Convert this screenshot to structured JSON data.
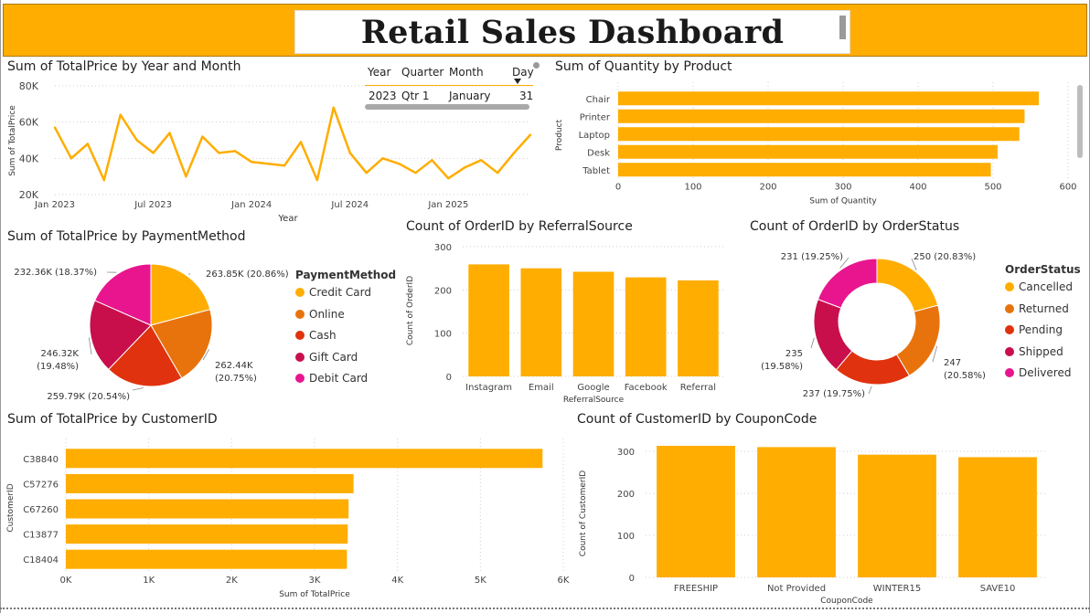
{
  "dashboard": {
    "title": "Retail Sales Dashboard"
  },
  "colors": {
    "accent": "#FFAD00",
    "credit_card": "#FFAD00",
    "online": "#E8730C",
    "cash": "#E0320E",
    "gift_card": "#C80F4C",
    "debit_card": "#E8158E"
  },
  "slicer": {
    "headers": [
      "Year",
      "Quarter",
      "Month",
      "Day"
    ],
    "values": [
      "2023",
      "Qtr 1",
      "January",
      "31"
    ]
  },
  "panels": {
    "line": {
      "title": "Sum of TotalPrice by Year and Month"
    },
    "product": {
      "title": "Sum of Quantity by Product"
    },
    "payment": {
      "title": "Sum of TotalPrice by PaymentMethod"
    },
    "referral": {
      "title": "Count of OrderID by ReferralSource"
    },
    "status": {
      "title": "Count of OrderID by OrderStatus"
    },
    "customer": {
      "title": "Sum of TotalPrice by CustomerID"
    },
    "coupon": {
      "title": "Count of CustomerID by CouponCode"
    }
  },
  "chart_data": [
    {
      "id": "line",
      "type": "line",
      "title": "Sum of TotalPrice by Year and Month",
      "xlabel": "Year",
      "ylabel": "Sum of TotalPrice",
      "ylim": [
        20000,
        80000
      ],
      "y_ticks": [
        "20K",
        "40K",
        "60K",
        "80K"
      ],
      "x_ticks": [
        "Jan 2023",
        "Jul 2023",
        "Jan 2024",
        "Jul 2024",
        "Jan 2025"
      ],
      "x": [
        "2023-01",
        "2023-02",
        "2023-03",
        "2023-04",
        "2023-05",
        "2023-06",
        "2023-07",
        "2023-08",
        "2023-09",
        "2023-10",
        "2023-11",
        "2023-12",
        "2024-01",
        "2024-02",
        "2024-03",
        "2024-04",
        "2024-05",
        "2024-06",
        "2024-07",
        "2024-08",
        "2024-09",
        "2024-10",
        "2024-11",
        "2024-12",
        "2025-01",
        "2025-02",
        "2025-03",
        "2025-04",
        "2025-05",
        "2025-06"
      ],
      "values": [
        57000,
        40000,
        48000,
        28000,
        64000,
        50000,
        43000,
        54000,
        30000,
        52000,
        43000,
        44000,
        38000,
        37000,
        36000,
        49000,
        28000,
        68000,
        43000,
        32000,
        40000,
        37000,
        32000,
        39000,
        29000,
        35000,
        39000,
        32000,
        43000,
        53000
      ]
    },
    {
      "id": "product",
      "type": "bar",
      "orientation": "horizontal",
      "title": "Sum of Quantity by Product",
      "xlabel": "Sum of Quantity",
      "ylabel": "Product",
      "categories": [
        "Chair",
        "Printer",
        "Laptop",
        "Desk",
        "Tablet"
      ],
      "values": [
        561,
        542,
        535,
        506,
        497
      ],
      "xlim": [
        0,
        600
      ],
      "x_ticks": [
        "0",
        "100",
        "200",
        "300",
        "400",
        "500",
        "600"
      ]
    },
    {
      "id": "payment",
      "type": "pie",
      "title": "Sum of TotalPrice by PaymentMethod",
      "legend_title": "PaymentMethod",
      "categories": [
        "Credit Card",
        "Online",
        "Cash",
        "Gift Card",
        "Debit Card"
      ],
      "values": [
        263850,
        262440,
        259790,
        246320,
        232360
      ],
      "labels": [
        "263.85K (20.86%)",
        "262.44K (20.75%)",
        "259.79K (20.54%)",
        "246.32K (19.48%)",
        "232.36K (18.37%)"
      ],
      "legend_placement": "right"
    },
    {
      "id": "referral",
      "type": "bar",
      "title": "Count of OrderID by ReferralSource",
      "xlabel": "ReferralSource",
      "ylabel": "Count of OrderID",
      "categories": [
        "Instagram",
        "Email",
        "Google",
        "Facebook",
        "Referral"
      ],
      "values": [
        259,
        250,
        242,
        229,
        222
      ],
      "ylim": [
        0,
        300
      ],
      "y_ticks": [
        "0",
        "100",
        "200",
        "300"
      ]
    },
    {
      "id": "status",
      "type": "pie",
      "donut": true,
      "title": "Count of OrderID by OrderStatus",
      "legend_title": "OrderStatus",
      "categories": [
        "Cancelled",
        "Returned",
        "Pending",
        "Shipped",
        "Delivered"
      ],
      "values": [
        250,
        247,
        237,
        235,
        231
      ],
      "labels": [
        "250 (20.83%)",
        "247 (20.58%)",
        "237 (19.75%)",
        "235 (19.58%)",
        "231 (19.25%)"
      ],
      "legend_placement": "right"
    },
    {
      "id": "customer",
      "type": "bar",
      "orientation": "horizontal",
      "title": "Sum of TotalPrice by CustomerID",
      "xlabel": "Sum of TotalPrice",
      "ylabel": "CustomerID",
      "categories": [
        "C38840",
        "C57276",
        "C67260",
        "C13877",
        "C18404"
      ],
      "values": [
        5750,
        3470,
        3410,
        3400,
        3390
      ],
      "xlim": [
        0,
        6000
      ],
      "x_ticks": [
        "0K",
        "1K",
        "2K",
        "3K",
        "4K",
        "5K",
        "6K"
      ]
    },
    {
      "id": "coupon",
      "type": "bar",
      "title": "Count of CustomerID by CouponCode",
      "xlabel": "CouponCode",
      "ylabel": "Count of CustomerID",
      "categories": [
        "FREESHIP",
        "Not Provided",
        "WINTER15",
        "SAVE10"
      ],
      "values": [
        313,
        310,
        292,
        286
      ],
      "ylim": [
        0,
        300
      ],
      "y_ticks": [
        "0",
        "100",
        "200",
        "300"
      ]
    }
  ]
}
